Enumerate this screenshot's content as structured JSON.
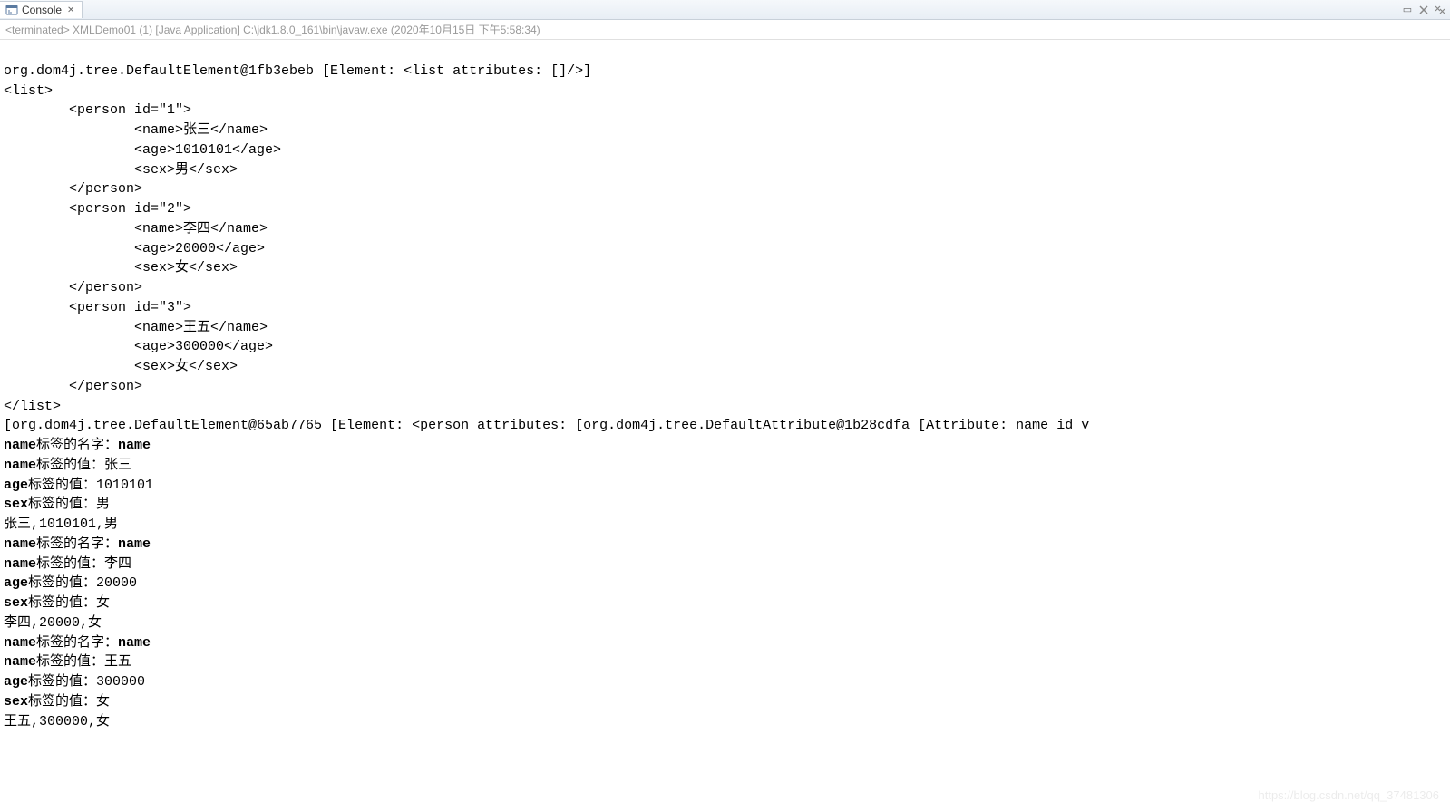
{
  "tab": {
    "label": "Console",
    "close_glyph": "✕"
  },
  "controls": {
    "minimize_glyph": "▭",
    "remove_glyph": "✖",
    "more_glyph": "⋮"
  },
  "status": {
    "text": "<terminated> XMLDemo01 (1) [Java Application] C:\\jdk1.8.0_161\\bin\\javaw.exe (2020年10月15日 下午5:58:34)"
  },
  "output": {
    "line01": "org.dom4j.tree.DefaultElement@1fb3ebeb [Element: <list attributes: []/>]",
    "line02": "<list>",
    "line03": "        <person id=\"1\">",
    "line04": "                <name>张三</name>",
    "line05": "                <age>1010101</age>",
    "line06": "                <sex>男</sex>",
    "line07": "        </person>",
    "line08": "        <person id=\"2\">",
    "line09": "                <name>李四</name>",
    "line10": "                <age>20000</age>",
    "line11": "                <sex>女</sex>",
    "line12": "        </person>",
    "line13": "        <person id=\"3\">",
    "line14": "                <name>王五</name>",
    "line15": "                <age>300000</age>",
    "line16": "                <sex>女</sex>",
    "line17": "        </person>",
    "line18": "</list>",
    "line19": "[org.dom4j.tree.DefaultElement@65ab7765 [Element: <person attributes: [org.dom4j.tree.DefaultAttribute@1b28cdfa [Attribute: name id v",
    "p1_name_label_bold": "name",
    "p1_name_label_rest": "标签的名字：",
    "p1_name_label_val": "name",
    "p1_name_val_bold": "name",
    "p1_name_val_rest": "标签的值：张三",
    "p1_age_bold": "age",
    "p1_age_rest": "标签的值：1010101",
    "p1_sex_bold": "sex",
    "p1_sex_rest": "标签的值：男",
    "p1_csv": "张三,1010101,男",
    "p2_name_label_bold": "name",
    "p2_name_label_rest": "标签的名字：",
    "p2_name_label_val": "name",
    "p2_name_val_bold": "name",
    "p2_name_val_rest": "标签的值：李四",
    "p2_age_bold": "age",
    "p2_age_rest": "标签的值：20000",
    "p2_sex_bold": "sex",
    "p2_sex_rest": "标签的值：女",
    "p2_csv": "李四,20000,女",
    "p3_name_label_bold": "name",
    "p3_name_label_rest": "标签的名字：",
    "p3_name_label_val": "name",
    "p3_name_val_bold": "name",
    "p3_name_val_rest": "标签的值：王五",
    "p3_age_bold": "age",
    "p3_age_rest": "标签的值：300000",
    "p3_sex_bold": "sex",
    "p3_sex_rest": "标签的值：女",
    "p3_csv": "王五,300000,女"
  },
  "watermark": "https://blog.csdn.net/qq_37481306"
}
